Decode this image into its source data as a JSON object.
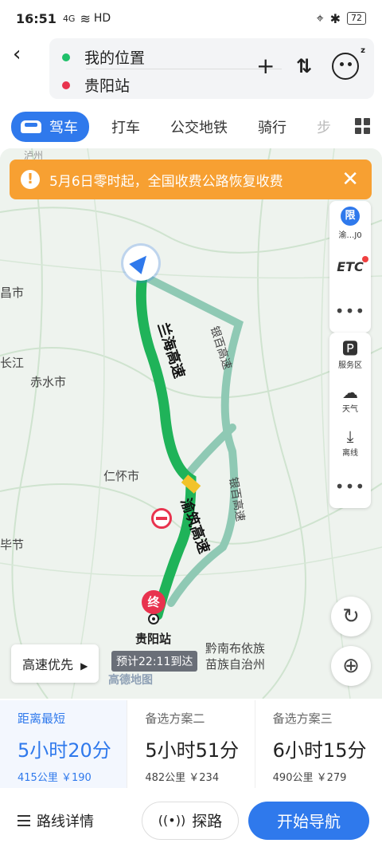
{
  "status_bar": {
    "time": "16:51",
    "signal": "4G",
    "network": "HD",
    "battery": "72"
  },
  "route": {
    "start": "我的位置",
    "end": "贵阳站"
  },
  "tabs": [
    {
      "label": "驾车",
      "active": true
    },
    {
      "label": "打车"
    },
    {
      "label": "公交地铁"
    },
    {
      "label": "骑行"
    },
    {
      "label": "步"
    }
  ],
  "notice": {
    "text": "5月6日零时起，全国收费公路恢复收费"
  },
  "side_panel": {
    "restrict_badge": "限",
    "restrict_label": "渝…J0",
    "etc_label": "ETC",
    "service_area": "服务区",
    "weather": "天气",
    "offline": "离线"
  },
  "map": {
    "highway_labels": [
      "兰海高速",
      "渝筑高速",
      "银百高速",
      "银百高速"
    ],
    "places": [
      {
        "id": "xishui",
        "name": "赤水市"
      },
      {
        "id": "renhuai",
        "name": "仁怀市"
      },
      {
        "id": "guiyang",
        "name": "贵阳站"
      },
      {
        "id": "qiannan1",
        "name": "黔南布依族"
      },
      {
        "id": "qiannan2",
        "name": "苗族自治州"
      },
      {
        "id": "changchang",
        "name": "昌市"
      },
      {
        "id": "changjiang",
        "name": "长江"
      },
      {
        "id": "bijie",
        "name": "毕节"
      },
      {
        "id": "luzhou",
        "name": "泸州"
      }
    ],
    "end_marker": "终",
    "eta": "预计22:11到达",
    "brand": "高德地图",
    "pref_button": "高速优先",
    "colors": {
      "route": "#1fb359",
      "alt_route": "#8fc9b4",
      "accent": "#2f79ec",
      "warning": "#f7a032"
    }
  },
  "plans": [
    {
      "name": "距离最短",
      "duration": "5小时20分",
      "meta": "415公里 ￥190",
      "selected": true
    },
    {
      "name": "备选方案二",
      "duration": "5小时51分",
      "meta": "482公里 ￥234"
    },
    {
      "name": "备选方案三",
      "duration": "6小时15分",
      "meta": "490公里 ￥279"
    }
  ],
  "bottom": {
    "details": "路线详情",
    "explore": "探路",
    "navigate": "开始导航"
  }
}
